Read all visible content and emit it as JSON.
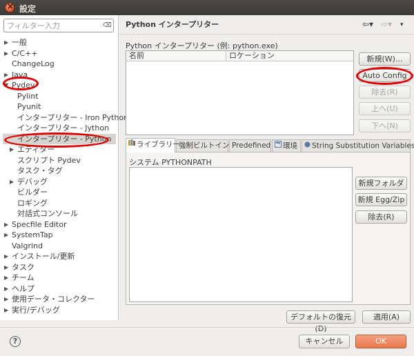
{
  "window": {
    "title": "設定"
  },
  "sidebar": {
    "filter_placeholder": "フィルター入力",
    "tree": [
      {
        "label": "一般",
        "indent": 0,
        "expander": "closed"
      },
      {
        "label": "C/C++",
        "indent": 0,
        "expander": "closed"
      },
      {
        "label": "ChangeLog",
        "indent": 0,
        "expander": "none"
      },
      {
        "label": "Java",
        "indent": 0,
        "expander": "closed"
      },
      {
        "label": "Pydev",
        "indent": 0,
        "expander": "open"
      },
      {
        "label": "Pylint",
        "indent": 1,
        "expander": "none"
      },
      {
        "label": "Pyunit",
        "indent": 1,
        "expander": "none"
      },
      {
        "label": "インタープリター - Iron Python",
        "indent": 1,
        "expander": "none"
      },
      {
        "label": "インタープリター - Jython",
        "indent": 1,
        "expander": "none"
      },
      {
        "label": "インタープリター - Python",
        "indent": 1,
        "expander": "none",
        "selected": true
      },
      {
        "label": "エディター",
        "indent": 1,
        "expander": "closed"
      },
      {
        "label": "スクリプト Pydev",
        "indent": 1,
        "expander": "none"
      },
      {
        "label": "タスク・タグ",
        "indent": 1,
        "expander": "none"
      },
      {
        "label": "デバッグ",
        "indent": 1,
        "expander": "closed"
      },
      {
        "label": "ビルダー",
        "indent": 1,
        "expander": "none"
      },
      {
        "label": "ロギング",
        "indent": 1,
        "expander": "none"
      },
      {
        "label": "対話式コンソール",
        "indent": 1,
        "expander": "none"
      },
      {
        "label": "Specfile Editor",
        "indent": 0,
        "expander": "closed"
      },
      {
        "label": "SystemTap",
        "indent": 0,
        "expander": "closed"
      },
      {
        "label": "Valgrind",
        "indent": 0,
        "expander": "none"
      },
      {
        "label": "インストール/更新",
        "indent": 0,
        "expander": "closed"
      },
      {
        "label": "タスク",
        "indent": 0,
        "expander": "closed"
      },
      {
        "label": "チーム",
        "indent": 0,
        "expander": "closed"
      },
      {
        "label": "ヘルプ",
        "indent": 0,
        "expander": "closed"
      },
      {
        "label": "使用データ・コレクター",
        "indent": 0,
        "expander": "closed"
      },
      {
        "label": "実行/デバッグ",
        "indent": 0,
        "expander": "closed"
      }
    ]
  },
  "main": {
    "title": "Python インタープリター",
    "nav": {
      "back": "⇦▾",
      "forward": "⇨▾",
      "menu": "▾"
    },
    "interpreters_label": "Python インタープリター (例: python.exe)",
    "columns": [
      "名前",
      "ロケーション"
    ],
    "buttons": {
      "new": "新規(W)...",
      "auto_config": "Auto Config",
      "remove": "除去(R)",
      "up": "上へ(U)",
      "down": "下へ(N)"
    },
    "tabs": [
      {
        "label": "ライブラリー",
        "active": true,
        "icon": "library-icon"
      },
      {
        "label": "強制ビルトイン",
        "active": false
      },
      {
        "label": "Predefined",
        "active": false
      },
      {
        "label": "環境",
        "active": false,
        "icon": "environment-icon"
      },
      {
        "label": "String Substitution Variables",
        "active": false,
        "icon": "variables-icon"
      }
    ],
    "system_pythonpath_label": "システム PYTHONPATH",
    "path_buttons": {
      "new_folder": "新規フォルダー",
      "new_egg": "新規 Egg/Zip",
      "remove": "除去(R)"
    },
    "restore_defaults": "デフォルトの復元(D)",
    "apply": "適用(A)"
  },
  "footer": {
    "help": "?",
    "cancel": "キャンセル",
    "ok": "OK"
  },
  "colors": {
    "ok_button": "#e9784c",
    "annotation_red": "#e00000",
    "selection": "#d7d4cf"
  }
}
